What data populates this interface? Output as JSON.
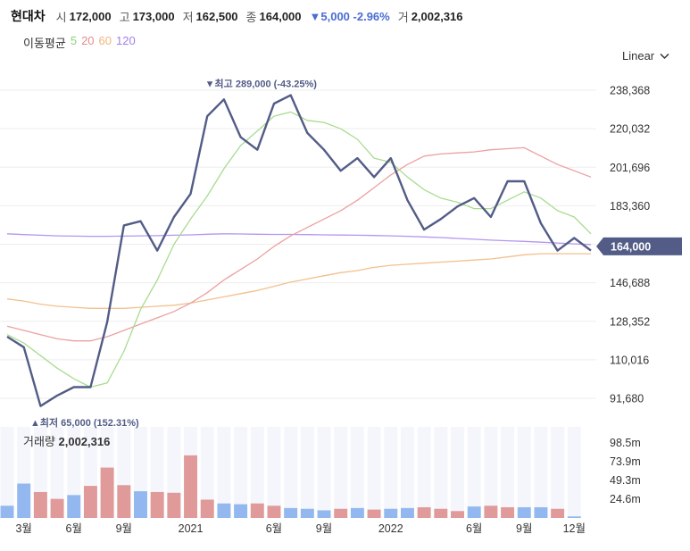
{
  "header": {
    "name": "현대차",
    "open_label": "시",
    "open": "172,000",
    "high_label": "고",
    "high": "173,000",
    "low_label": "저",
    "low": "162,500",
    "close_label": "종",
    "close": "164,000",
    "change": "▼5,000 -2.96%",
    "volume_label": "거",
    "volume": "2,002,316"
  },
  "ma_legend": {
    "label": "이동평균",
    "p5": "5",
    "p20": "20",
    "p60": "60",
    "p120": "120"
  },
  "scale_selector": {
    "label": "Linear"
  },
  "colors": {
    "price": "#525c86",
    "ma5": "#a8dc8f",
    "ma20": "#eca0a0",
    "ma60": "#f2c08e",
    "ma120": "#b496f0",
    "vol_up": "#e09a9a",
    "vol_down": "#93b8ef",
    "bg_band": "#f4f6fc",
    "badge": "#525c86"
  },
  "chart_data": [
    {
      "type": "line",
      "title": "",
      "y_ticks": [
        "238,368",
        "220,032",
        "201,696",
        "183,360",
        "164,000",
        "146,688",
        "128,352",
        "110,016",
        "91,680"
      ],
      "y_tick_values": [
        238368,
        220032,
        201696,
        183360,
        165024,
        146688,
        128352,
        110016,
        91680
      ],
      "x_ticks": [
        "3월",
        "6월",
        "9월",
        "2021",
        "6월",
        "9월",
        "2022",
        "6월",
        "9월",
        "12월"
      ],
      "x_tick_index": [
        1,
        4,
        7,
        11,
        16,
        19,
        23,
        28,
        31,
        34
      ],
      "current_price": 164000,
      "current_label": "164,000",
      "max_annotation": "▼최고 289,000 (-43.25%)",
      "min_annotation": "▲최저 65,000 (152.31%)",
      "series": [
        {
          "name": "",
          "values": [
            121000,
            116000,
            88000,
            93000,
            97000,
            97000,
            128000,
            174000,
            176000,
            162000,
            178000,
            189000,
            226000,
            234000,
            216000,
            210000,
            232000,
            236000,
            218000,
            210000,
            200000,
            206000,
            197000,
            206000,
            186000,
            172000,
            177000,
            183000,
            187000,
            178000,
            195000,
            195000,
            175000,
            162000,
            168000,
            162000
          ]
        },
        {
          "name": "5",
          "values": [
            122000,
            118000,
            112000,
            106000,
            101000,
            97000,
            99000,
            114000,
            134000,
            148000,
            165000,
            177000,
            188000,
            201000,
            212000,
            219000,
            226000,
            228000,
            224000,
            223000,
            220000,
            215000,
            206000,
            204000,
            197000,
            191000,
            187000,
            185000,
            182000,
            182000,
            186000,
            190000,
            187000,
            181000,
            178000,
            170000
          ]
        },
        {
          "name": "20",
          "values": [
            126000,
            124000,
            122000,
            120000,
            119000,
            119000,
            121000,
            124000,
            127000,
            130000,
            133000,
            137000,
            142000,
            148000,
            153000,
            158000,
            164000,
            169000,
            173000,
            177000,
            181000,
            186000,
            192000,
            198000,
            203000,
            207000,
            208000,
            208500,
            209000,
            210000,
            210500,
            211000,
            207000,
            203000,
            200000,
            197000
          ]
        },
        {
          "name": "60",
          "values": [
            139000,
            138000,
            136500,
            135500,
            135000,
            134500,
            134500,
            134500,
            135000,
            135500,
            136000,
            137000,
            138500,
            140000,
            141500,
            143000,
            145000,
            147000,
            148500,
            150000,
            151500,
            152500,
            154000,
            155000,
            155500,
            156000,
            156500,
            157000,
            157500,
            158000,
            159000,
            160000,
            160500,
            160500,
            160500,
            160500
          ]
        },
        {
          "name": "120",
          "values": [
            170000,
            169600,
            169300,
            169000,
            168900,
            168800,
            168800,
            168900,
            169000,
            169100,
            169300,
            169500,
            169800,
            170000,
            169900,
            169800,
            169700,
            169700,
            169600,
            169500,
            169400,
            169300,
            169200,
            169000,
            168800,
            168500,
            168200,
            167800,
            167400,
            167000,
            166700,
            166400,
            166000,
            165600,
            165200,
            164900
          ]
        }
      ]
    },
    {
      "type": "bar",
      "title": "",
      "label": "거래량",
      "label_value": "2,002,316",
      "y_ticks": [
        "98.5m",
        "73.9m",
        "49.3m",
        "24.6m"
      ],
      "y_tick_values": [
        98.5,
        73.9,
        49.3,
        24.6
      ],
      "ylim": [
        0,
        124
      ],
      "values": [
        16,
        45,
        34,
        25,
        30,
        42,
        66,
        43,
        35,
        34,
        33,
        82,
        24,
        19,
        18,
        19,
        16,
        13,
        12,
        10,
        12,
        13,
        11,
        12,
        13,
        14,
        12,
        9,
        15,
        16,
        14,
        14,
        14,
        12,
        2
      ],
      "up": [
        false,
        false,
        true,
        true,
        false,
        true,
        true,
        true,
        false,
        true,
        true,
        true,
        true,
        false,
        false,
        true,
        true,
        false,
        false,
        false,
        true,
        false,
        true,
        false,
        false,
        true,
        true,
        true,
        false,
        true,
        true,
        false,
        false,
        true,
        false
      ]
    }
  ]
}
